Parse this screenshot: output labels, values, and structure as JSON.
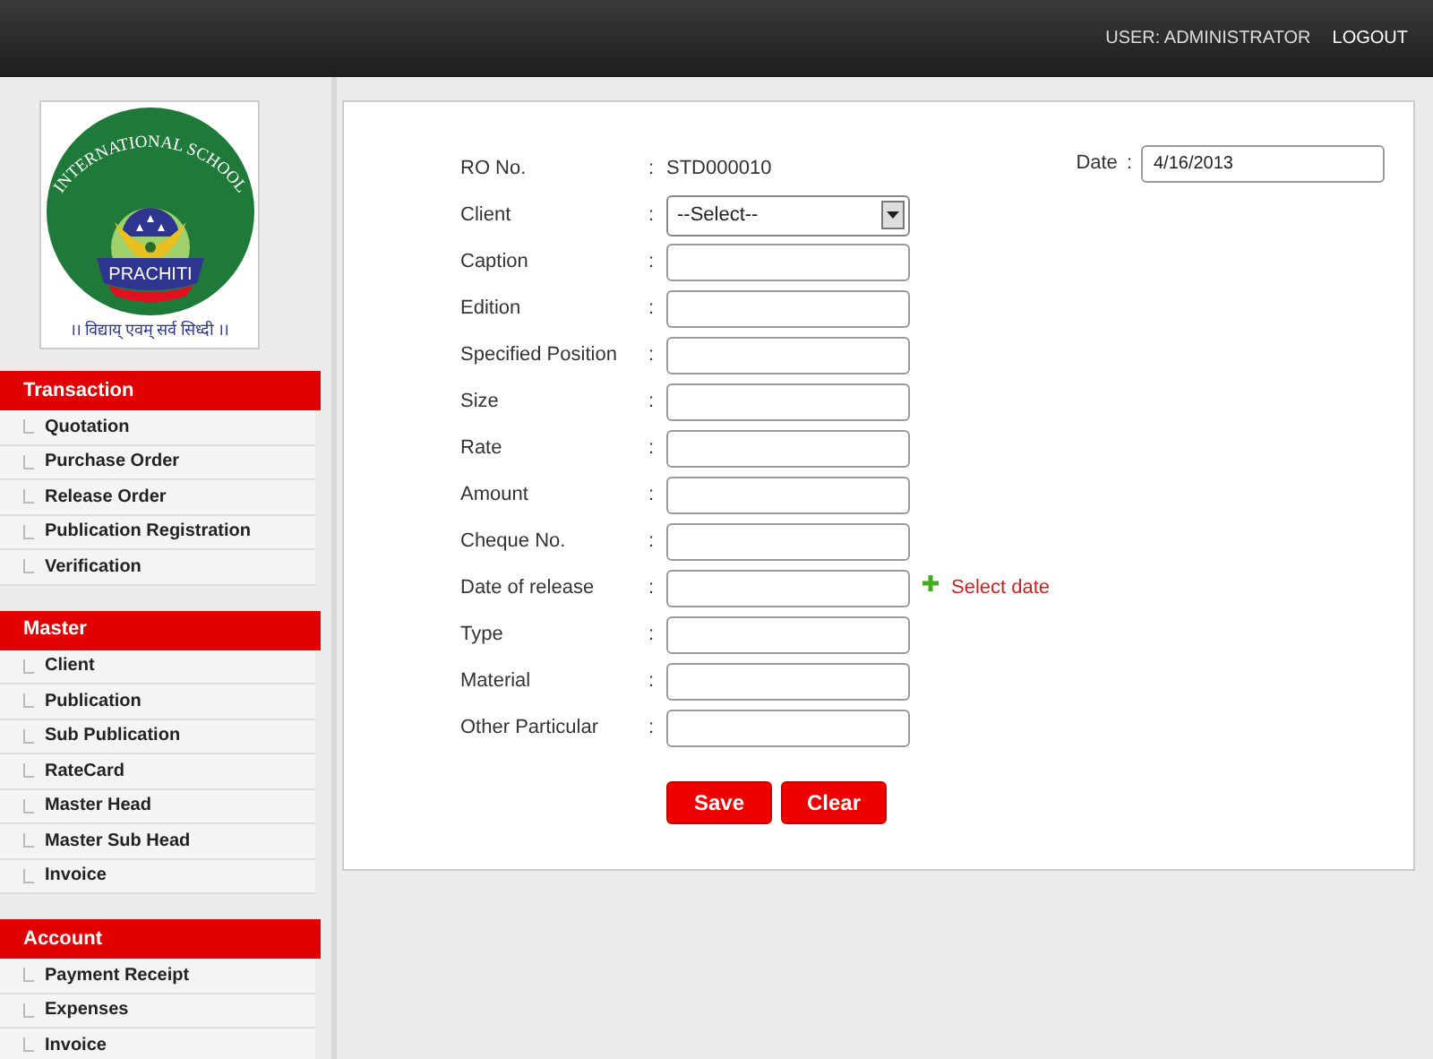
{
  "header": {
    "user": "USER: ADMINISTRATOR",
    "logout": "LOGOUT"
  },
  "logo": {
    "arc": "INTERNATIONAL SCHOOL",
    "name": "PRACHITI",
    "motto": "।। विद्याय् एवम् सर्व सिध्दी ।।"
  },
  "sidebar": [
    {
      "title": "Transaction",
      "items": [
        "Quotation",
        "Purchase Order",
        "Release Order",
        "Publication Registration",
        "Verification"
      ]
    },
    {
      "title": "Master",
      "items": [
        "Client",
        "Publication",
        "Sub Publication",
        "RateCard",
        "Master Head",
        "Master Sub Head",
        "Invoice"
      ]
    },
    {
      "title": "Account",
      "items": [
        "Payment Receipt",
        "Expenses",
        "Invoice"
      ]
    }
  ],
  "form": {
    "date_label": "Date",
    "date_separator": ":",
    "date_value": "4/16/2013",
    "fields": [
      {
        "kind": "static",
        "label": "RO No.",
        "separator": ":",
        "value": "STD000010"
      },
      {
        "kind": "select",
        "label": "Client",
        "separator": ":",
        "value": "--Select--"
      },
      {
        "kind": "input",
        "label": "Caption",
        "separator": ":"
      },
      {
        "kind": "input",
        "label": "Edition",
        "separator": ":"
      },
      {
        "kind": "input",
        "label": "Specified Position",
        "separator": ":"
      },
      {
        "kind": "input",
        "label": "Size",
        "separator": ":"
      },
      {
        "kind": "input",
        "label": "Rate",
        "separator": ":"
      },
      {
        "kind": "input",
        "label": "Amount",
        "separator": ":"
      },
      {
        "kind": "input",
        "label": "Cheque No.",
        "separator": ":"
      },
      {
        "kind": "date",
        "label": "Date of release",
        "separator": ":",
        "link": "Select date"
      },
      {
        "kind": "input",
        "label": "Type",
        "separator": ":"
      },
      {
        "kind": "input",
        "label": "Material",
        "separator": ":"
      },
      {
        "kind": "input",
        "label": "Other Particular",
        "separator": ":"
      }
    ],
    "buttons": [
      "Save",
      "Clear"
    ]
  }
}
